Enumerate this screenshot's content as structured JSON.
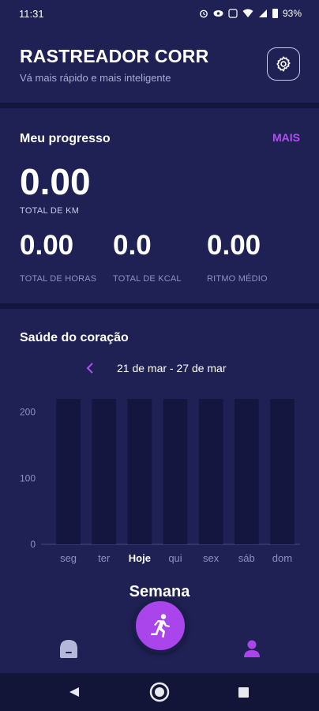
{
  "status_bar": {
    "time": "11:31",
    "battery": "93%"
  },
  "header": {
    "title": "RASTREADOR CORR",
    "subtitle": "Vá mais rápido e mais inteligente",
    "settings_icon": "gear-icon"
  },
  "progress": {
    "title": "Meu progresso",
    "more_label": "MAIS",
    "total_km_value": "0.00",
    "total_km_label": "TOTAL DE KM",
    "stats": [
      {
        "value": "0.00",
        "label": "TOTAL DE HORAS"
      },
      {
        "value": "0.0",
        "label": "TOTAL DE KCAL"
      },
      {
        "value": "0.00",
        "label": "RITMO MÉDIO"
      }
    ]
  },
  "heart": {
    "title": "Saúde do coração",
    "date_range": "21 de mar - 27 de mar",
    "week_label": "Semana"
  },
  "colors": {
    "background": "#1f2154",
    "divider": "#141640",
    "accent": "#a945ea",
    "bar": "#141640"
  },
  "chart_data": {
    "type": "bar",
    "categories": [
      "seg",
      "ter",
      "Hoje",
      "qui",
      "sex",
      "sáb",
      "dom"
    ],
    "values": [
      220,
      220,
      220,
      220,
      220,
      220,
      220
    ],
    "y_ticks": [
      "0",
      "100",
      "200"
    ],
    "ylim": [
      0,
      220
    ],
    "highlight_category": "Hoje",
    "grid": false
  },
  "bottom_nav": {
    "home_icon": "home-icon",
    "fab_icon": "running-person-icon",
    "profile_icon": "profile-icon"
  }
}
